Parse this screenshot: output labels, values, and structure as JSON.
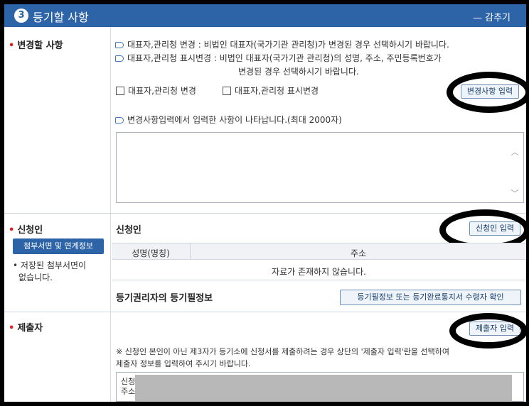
{
  "header": {
    "step_number": "3",
    "title": "등기할 사항",
    "collapse_label": "— 감추기"
  },
  "change_section": {
    "label": "변경할 사항",
    "note1": "대표자,관리청 변경 : 비법인 대표자(국가기관 관리청)가 변경된 경우 선택하시기 바랍니다.",
    "note2_line1": "대표자,관리청 표시변경 : 비법인 대표자(국가기관 관리청)의 성명, 주소, 주민등록번호가",
    "note2_line2": "변경된 경우 선택하시기 바랍니다.",
    "checkbox1_label": "대표자,관리청 변경",
    "checkbox2_label": "대표자,관리청 표시변경",
    "input_button_label": "변경사항 입력",
    "display_note": "변경사항입력에서 입력한 사항이 나타납니다.(최대 2000자)"
  },
  "applicant_section": {
    "label": "신청인",
    "attach_button_label": "첨부서면 및 연계정보",
    "saved_note_line1": "• 저장된 첨부서면이",
    "saved_note_line2": "없습니다.",
    "sub_title": "신청인",
    "input_button_label": "신청인 입력",
    "table_headers": [
      "성명(명칭)",
      "주소"
    ],
    "empty_message": "자료가 존재하지 않습니다.",
    "rights_title": "등기권리자의 등기필정보",
    "rights_button_label": "등기필정보 또는 등기완료통지서 수령자 확인"
  },
  "submitter_section": {
    "label": "제출자",
    "input_button_label": "제출자 입력",
    "note_line1": "※ 신청인 본인이 아닌 제3자가 등기소에 신청서를 제출하려는 경우 상단의 '제출자 입력'란을 선택하여",
    "note_line2": "제출자 정보를 입력하여 주시기 바랍니다.",
    "info_line1": "신청",
    "info_line2": "주소"
  },
  "colors": {
    "header_blue": "#2d64a8",
    "required_star": "#dd2222",
    "redaction_oval": "#000000"
  }
}
